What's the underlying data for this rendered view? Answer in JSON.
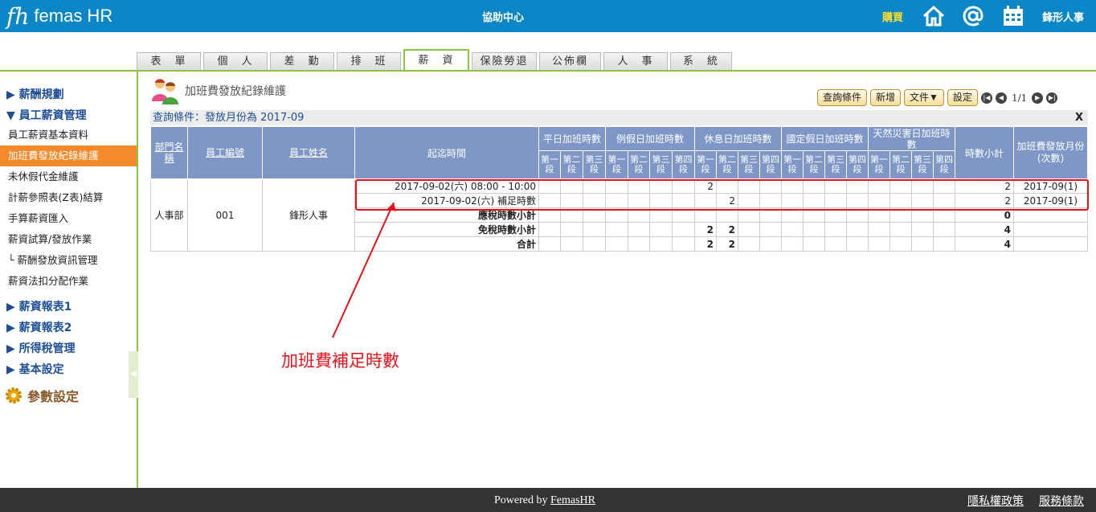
{
  "header": {
    "logo_mark": "fh",
    "logo_text": "femas HR",
    "help_center": "協助中心",
    "buy": "購買",
    "company": "鋒形人事",
    "colors": {
      "bar": "#0b86c7",
      "buy": "#ffde2a"
    },
    "icons": [
      "home-icon",
      "at-icon",
      "calendar-icon"
    ]
  },
  "tabs": [
    {
      "label": "表　單",
      "active": false
    },
    {
      "label": "個　人",
      "active": false
    },
    {
      "label": "差　勤",
      "active": false
    },
    {
      "label": "排　班",
      "active": false
    },
    {
      "label": "薪　資",
      "active": true
    },
    {
      "label": "保險勞退",
      "active": false
    },
    {
      "label": "公佈欄",
      "active": false
    },
    {
      "label": "人　事",
      "active": false
    },
    {
      "label": "系　統",
      "active": false
    }
  ],
  "sidebar": {
    "groups": {
      "salary_rules": "▶ 薪酬規劃",
      "employee_salary": "▼ 員工薪資管理",
      "report1": "▶ 薪資報表1",
      "report2": "▶ 薪資報表2",
      "income_tax": "▶ 所得稅管理",
      "basic_settings": "▶ 基本設定",
      "param_settings": "參數設定"
    },
    "items": [
      "員工薪資基本資料",
      "加班費發放紀錄維護",
      "未休假代金維護",
      "計薪參照表(Z表)結算",
      "手算薪資匯入",
      "薪資試算/發放作業",
      "└ 薪酬發放資訊管理",
      "薪資法扣分配作業"
    ],
    "active_item": "加班費發放紀錄維護",
    "colors": {
      "active": "#f58a2b",
      "accent": "#8cc63f"
    }
  },
  "page": {
    "title": "加班費發放紀錄維護",
    "query": "查詢條件：發放月份為 2017-09",
    "close": "X"
  },
  "toolbar": {
    "query_btn": "查詢條件",
    "add_btn": "新增",
    "doc_btn": "文件▼",
    "settings_btn": "設定",
    "page_info": "1/1",
    "nav_icons": [
      "first-page-icon",
      "prev-page-icon",
      "next-page-icon",
      "last-page-icon"
    ]
  },
  "table": {
    "headers": {
      "dept": "部門名稱",
      "emp_no": "員工編號",
      "emp_name": "員工姓名",
      "period": "起迄時間",
      "weekday": "平日加班時數",
      "regular_off": "例假日加班時數",
      "rest_day": "休息日加班時數",
      "holiday": "國定假日加班時數",
      "disaster": "天然災害日加班時數",
      "hours_subtotal": "時數小計",
      "pay_month": "加班費發放月份(次數)"
    },
    "sub_headers": [
      "第一段",
      "第二段",
      "第三段",
      "第四段"
    ],
    "dept": "人事部",
    "emp_no": "001",
    "emp_name": "鋒形人事",
    "rows": [
      {
        "period": "2017-09-02(六) 08:00 - 10:00",
        "cells": [
          "",
          "",
          "",
          "",
          "",
          "",
          "",
          "2",
          "",
          "",
          "",
          "",
          "",
          "",
          "",
          "",
          "",
          "",
          ""
        ],
        "subtotal": "2",
        "pay_month": "2017-09(1)"
      },
      {
        "period": "2017-09-02(六)  補足時數",
        "cells": [
          "",
          "",
          "",
          "",
          "",
          "",
          "",
          "",
          "2",
          "",
          "",
          "",
          "",
          "",
          "",
          "",
          "",
          "",
          ""
        ],
        "subtotal": "2",
        "pay_month": "2017-09(1)"
      }
    ],
    "summary": [
      {
        "label": "應稅時數小計",
        "cells": [
          "",
          "",
          "",
          "",
          "",
          "",
          "",
          "",
          "",
          "",
          "",
          "",
          "",
          "",
          "",
          "",
          "",
          "",
          ""
        ],
        "subtotal": "0"
      },
      {
        "label": "免稅時數小計",
        "cells": [
          "",
          "",
          "",
          "",
          "",
          "",
          "",
          "2",
          "2",
          "",
          "",
          "",
          "",
          "",
          "",
          "",
          "",
          "",
          ""
        ],
        "subtotal": "4"
      },
      {
        "label": "合計",
        "cells": [
          "",
          "",
          "",
          "",
          "",
          "",
          "",
          "2",
          "2",
          "",
          "",
          "",
          "",
          "",
          "",
          "",
          "",
          "",
          ""
        ],
        "subtotal": "4"
      }
    ]
  },
  "annotation": {
    "text": "加班費補足時數",
    "color": "#e6121a"
  },
  "footer": {
    "powered_prefix": "Powered by ",
    "powered_link": "FemasHR",
    "privacy": "隱私權政策",
    "terms": "服務條款"
  }
}
